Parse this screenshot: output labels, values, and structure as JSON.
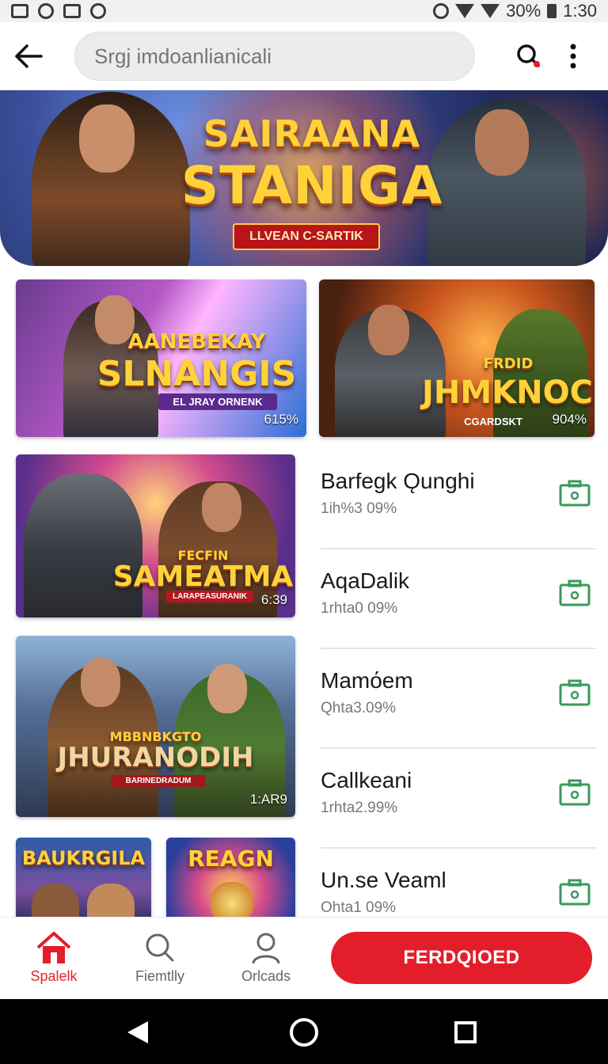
{
  "status_bar": {
    "battery": "30%",
    "time": "1:30"
  },
  "app_bar": {
    "search_placeholder": "Srgj imdoanlianicali",
    "back_icon": "back-arrow-icon",
    "search_icon": "search-icon",
    "more_icon": "more-vert-icon"
  },
  "hero": {
    "title_line1": "SAIRAANA",
    "title_line2": "STANIGA",
    "subtitle": "LLVEAN C-SARTIK"
  },
  "featured": [
    {
      "title": "AANEBEKAY",
      "title2": "SLNANGIS",
      "subtitle": "EL JRAY ORNENK",
      "percent": "615%"
    },
    {
      "title": "FRDID",
      "title2": "JHMKNOCH",
      "subtitle": "CGARDSKT",
      "percent": "904%"
    }
  ],
  "tiles": [
    {
      "title": "FECFIN",
      "title2": "SAMEATMA",
      "subtitle": "LARAPEASURANIK",
      "count": "6:39"
    },
    {
      "title": "MBBNBKGTO",
      "title2": "JHURANODIH",
      "subtitle": "BARINEDRADUM",
      "count": "1:AR9"
    },
    {
      "title": "BAUKRGILA"
    },
    {
      "title": "REAGN"
    }
  ],
  "list": [
    {
      "title": "Barfegk Ǫunghi",
      "sub": "1ih%3 09%"
    },
    {
      "title": "AqaDalik",
      "sub": "1rhta0 09%"
    },
    {
      "title": "Mamόem",
      "sub": "Qhta3.09%"
    },
    {
      "title": "Callkeani",
      "sub": "1rhta2.99%"
    },
    {
      "title": "Un.se Veaml",
      "sub": "Ohta1 09%"
    }
  ],
  "bottom_nav": {
    "items": [
      {
        "label": "Spalelk",
        "icon": "home-icon",
        "active": true
      },
      {
        "label": "Fiemtlly",
        "icon": "search-icon"
      },
      {
        "label": "Orlcads",
        "icon": "person-icon"
      }
    ],
    "cta_label": "FERDQIOED"
  },
  "colors": {
    "accent": "#e31e2a",
    "list_icon": "#3a9a5a"
  }
}
